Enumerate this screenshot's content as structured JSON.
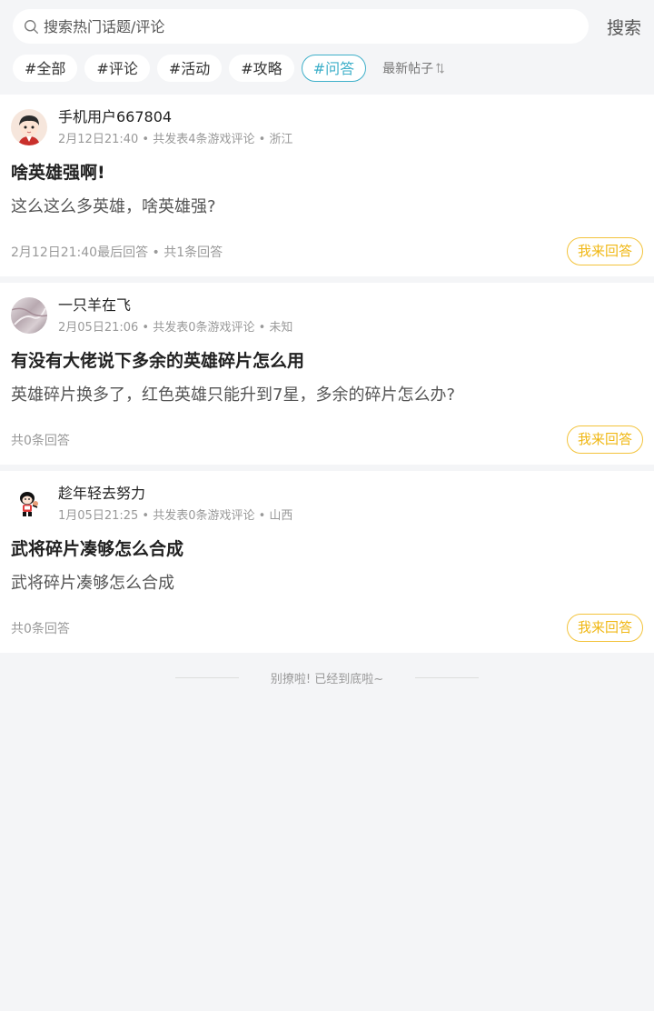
{
  "search": {
    "placeholder": "搜索热门话题/评论",
    "button_label": "搜索"
  },
  "tags": [
    {
      "label": "#全部",
      "active": false
    },
    {
      "label": "#评论",
      "active": false
    },
    {
      "label": "#活动",
      "active": false
    },
    {
      "label": "#攻略",
      "active": false
    },
    {
      "label": "#问答",
      "active": true
    }
  ],
  "sort": {
    "label": "最新帖子"
  },
  "colors": {
    "accent": "#3dafc9",
    "answer_button": "#f0b816",
    "background": "#f4f5f7"
  },
  "posts": [
    {
      "user": "手机用户667804",
      "meta": "2月12日21:40 • 共发表4条游戏评论 • 浙江",
      "title": "啥英雄强啊!",
      "body": "这么这么多英雄，啥英雄强?",
      "stats": "2月12日21:40最后回答 • 共1条回答",
      "answer_label": "我来回答"
    },
    {
      "user": "一只羊在飞",
      "meta": "2月05日21:06 • 共发表0条游戏评论 • 未知",
      "title": "有没有大佬说下多余的英雄碎片怎么用",
      "body": "英雄碎片换多了，红色英雄只能升到7星，多余的碎片怎么办?",
      "stats": "共0条回答",
      "answer_label": "我来回答"
    },
    {
      "user": "趁年轻去努力",
      "meta": "1月05日21:25 • 共发表0条游戏评论 • 山西",
      "title": "武将碎片凑够怎么合成",
      "body": "武将碎片凑够怎么合成",
      "stats": "共0条回答",
      "answer_label": "我来回答"
    }
  ],
  "footer": {
    "end_text": "别撩啦! 已经到底啦~"
  }
}
